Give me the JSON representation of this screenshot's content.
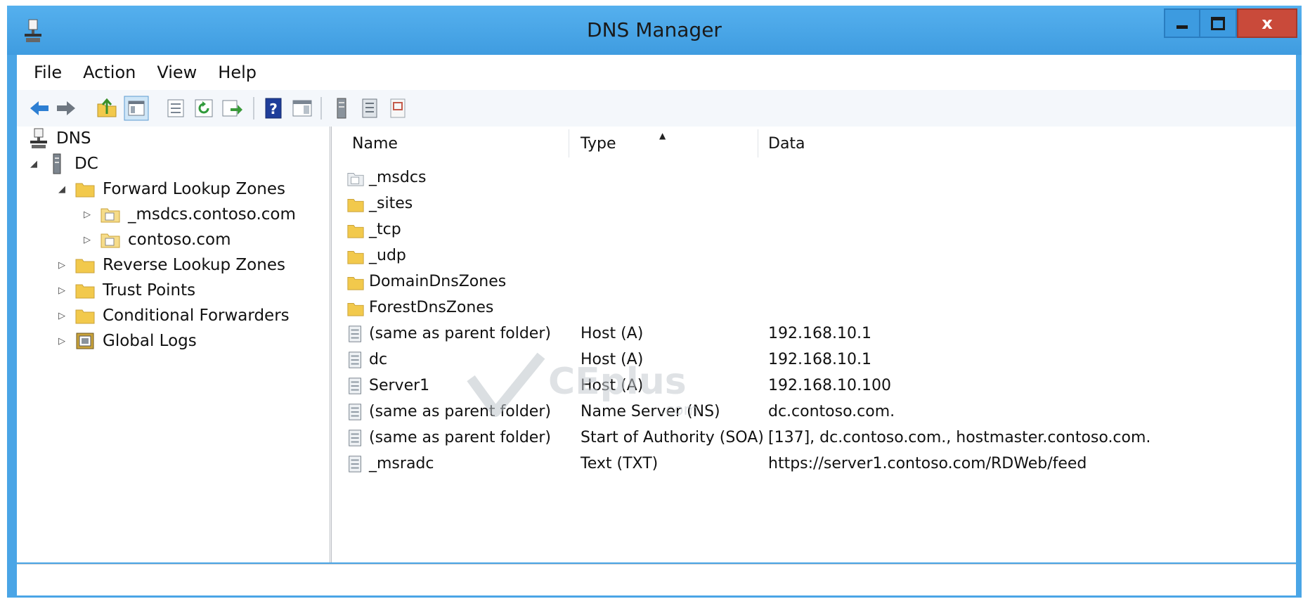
{
  "window": {
    "title": "DNS Manager",
    "controls": {
      "minimize": "–",
      "maximize": "□",
      "close": "x"
    }
  },
  "menu": {
    "items": [
      "File",
      "Action",
      "View",
      "Help"
    ]
  },
  "toolbar": {
    "icons": [
      "back-arrow-icon",
      "forward-arrow-icon",
      "up-folder-icon",
      "show-hide-console-tree-icon",
      "properties-icon",
      "refresh-icon",
      "export-list-icon",
      "help-icon",
      "show-action-pane-icon",
      "server-icon",
      "zone-list-icon",
      "zone-paper-icon"
    ]
  },
  "tree": {
    "root": "DNS",
    "server": "DC",
    "forward_lookup_zones": "Forward Lookup Zones",
    "zones": [
      "_msdcs.contoso.com",
      "contoso.com"
    ],
    "reverse_lookup_zones": "Reverse Lookup Zones",
    "trust_points": "Trust Points",
    "conditional_forwarders": "Conditional Forwarders",
    "global_logs": "Global Logs"
  },
  "list": {
    "columns": [
      "Name",
      "Type",
      "Data"
    ],
    "sort_column": "Type",
    "rows": [
      {
        "icon": "zone-folder-icon",
        "name": "_msdcs",
        "type": "",
        "data": ""
      },
      {
        "icon": "folder-icon",
        "name": "_sites",
        "type": "",
        "data": ""
      },
      {
        "icon": "folder-icon",
        "name": "_tcp",
        "type": "",
        "data": ""
      },
      {
        "icon": "folder-icon",
        "name": "_udp",
        "type": "",
        "data": ""
      },
      {
        "icon": "folder-icon",
        "name": "DomainDnsZones",
        "type": "",
        "data": ""
      },
      {
        "icon": "folder-icon",
        "name": "ForestDnsZones",
        "type": "",
        "data": ""
      },
      {
        "icon": "record-icon",
        "name": "(same as parent folder)",
        "type": "Host (A)",
        "data": "192.168.10.1"
      },
      {
        "icon": "record-icon",
        "name": "dc",
        "type": "Host (A)",
        "data": "192.168.10.1"
      },
      {
        "icon": "record-icon",
        "name": "Server1",
        "type": "Host (A)",
        "data": "192.168.10.100"
      },
      {
        "icon": "record-icon",
        "name": "(same as parent folder)",
        "type": "Name Server (NS)",
        "data": "dc.contoso.com."
      },
      {
        "icon": "record-icon",
        "name": "(same as parent folder)",
        "type": "Start of Authority (SOA)",
        "data": "[137], dc.contoso.com., hostmaster.contoso.com."
      },
      {
        "icon": "record-icon",
        "name": "_msradc",
        "type": "Text (TXT)",
        "data": "https://server1.contoso.com/RDWeb/feed"
      }
    ]
  },
  "watermark": {
    "text": "CEplus",
    "suffix": ".com"
  },
  "colors": {
    "titlebar": "#4aa5e6",
    "close_button": "#c94a3a",
    "folder": "#f2c94c"
  }
}
